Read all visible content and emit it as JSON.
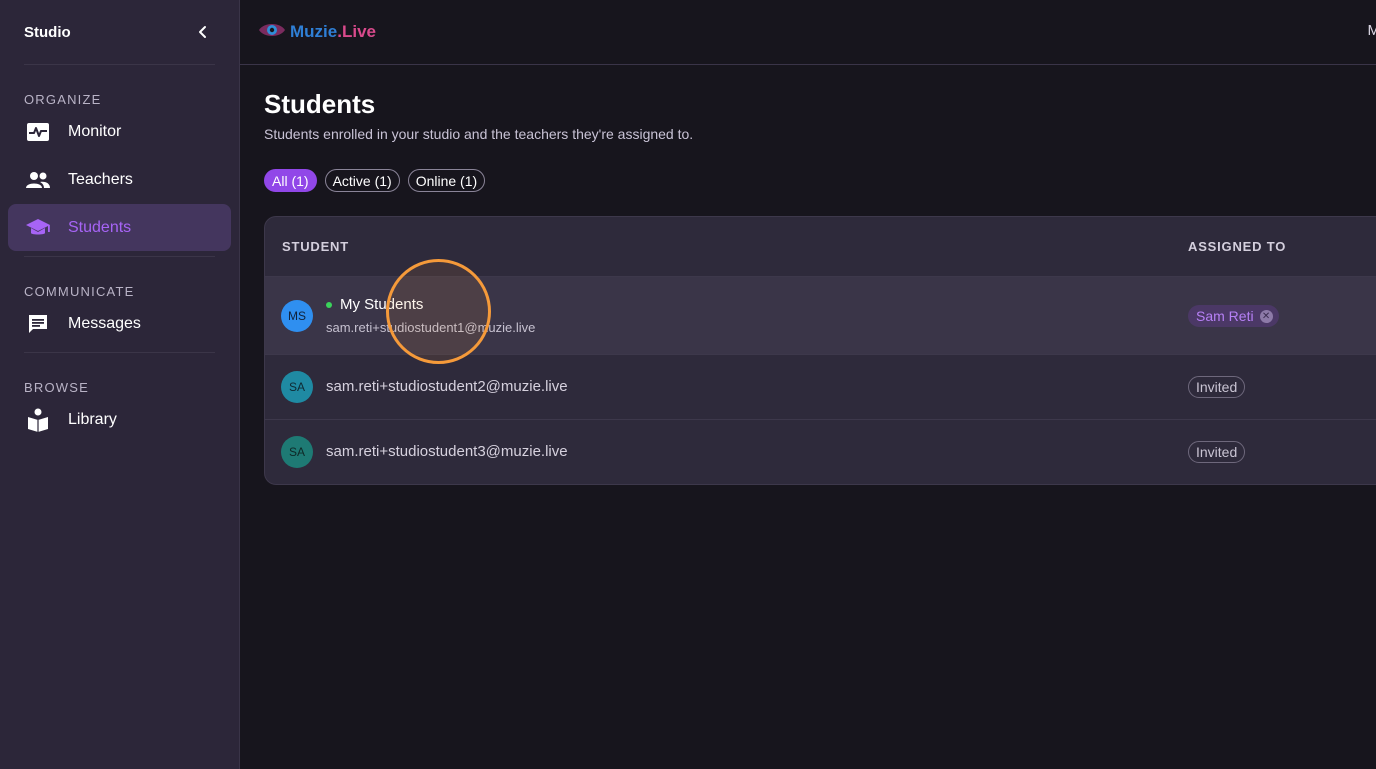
{
  "sidebar": {
    "title": "Studio",
    "sections": [
      {
        "label": "ORGANIZE"
      },
      {
        "label": "COMMUNICATE"
      },
      {
        "label": "BROWSE"
      }
    ],
    "items": {
      "monitor": "Monitor",
      "teachers": "Teachers",
      "students": "Students",
      "messages": "Messages",
      "library": "Library"
    }
  },
  "topbar": {
    "logo_part1": "Muzie",
    "logo_part2": ".Live",
    "right_partial": "M"
  },
  "page": {
    "title": "Students",
    "subtitle": "Students enrolled in your studio and the teachers they're assigned to."
  },
  "filters": [
    "All (1)",
    "Active (1)",
    "Online (1)"
  ],
  "table": {
    "headers": {
      "student": "STUDENT",
      "assigned": "ASSIGNED TO"
    },
    "rows": [
      {
        "initials": "MS",
        "name": "My Students",
        "email": "sam.reti+studiostudent1@muzie.live",
        "assigned": "Sam Reti"
      },
      {
        "initials": "SA",
        "email": "sam.reti+studiostudent2@muzie.live",
        "assigned": "Invited"
      },
      {
        "initials": "SA",
        "email": "sam.reti+studiostudent3@muzie.live",
        "assigned": "Invited"
      }
    ]
  },
  "colors": {
    "accent": "#9147e8",
    "sidebar_bg": "#2c2639",
    "online": "#3ad35b",
    "cursor_highlight": "#f59a3a"
  }
}
